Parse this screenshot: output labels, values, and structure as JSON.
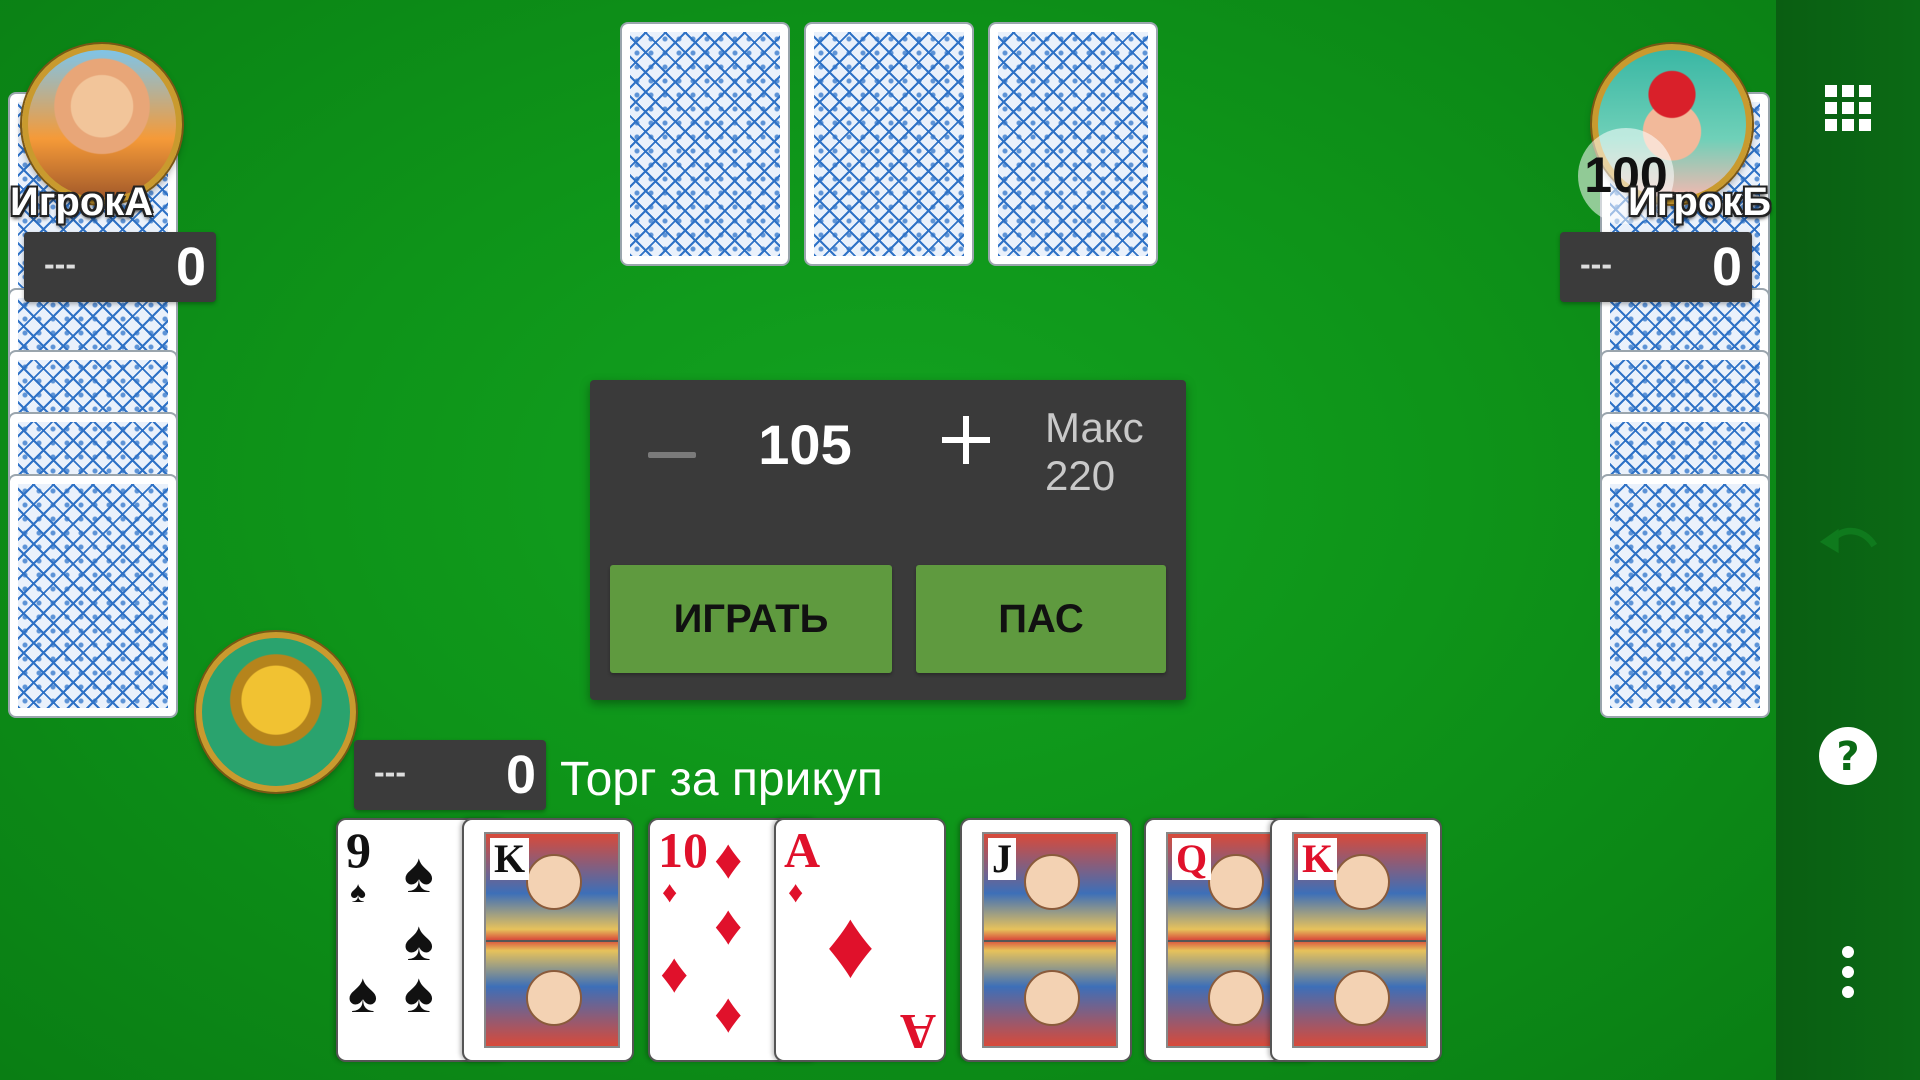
{
  "players": {
    "left": {
      "name": "ИгрокА",
      "bid": "---",
      "score": "0"
    },
    "right": {
      "name": "ИгрокБ",
      "bid": "---",
      "score": "0",
      "badge": "100"
    },
    "self": {
      "bid": "---",
      "score": "0"
    }
  },
  "status_text": "Торг за прикуп",
  "bid_panel": {
    "value": "105",
    "max_label": "Макс",
    "max_value": "220",
    "play_label": "ИГРАТЬ",
    "pass_label": "ПАС"
  },
  "colors": {
    "felt": "#0e9419",
    "panel": "#3a3a3a",
    "button": "#5f9a3f",
    "card_back": "#2f72c6"
  },
  "sidebar_icons": [
    "grid-menu-icon",
    "undo-icon",
    "help-icon",
    "more-vert-icon"
  ],
  "hand": [
    {
      "rank": "9",
      "suit": "♠",
      "color": "black"
    },
    {
      "rank": "K",
      "suit": "♠",
      "color": "black"
    },
    {
      "rank": "10",
      "suit": "♦",
      "color": "red"
    },
    {
      "rank": "A",
      "suit": "♦",
      "color": "red"
    },
    {
      "rank": "J",
      "suit": "♣",
      "color": "black"
    },
    {
      "rank": "Q",
      "suit": "♥",
      "color": "red"
    },
    {
      "rank": "K",
      "suit": "♥",
      "color": "red"
    }
  ]
}
